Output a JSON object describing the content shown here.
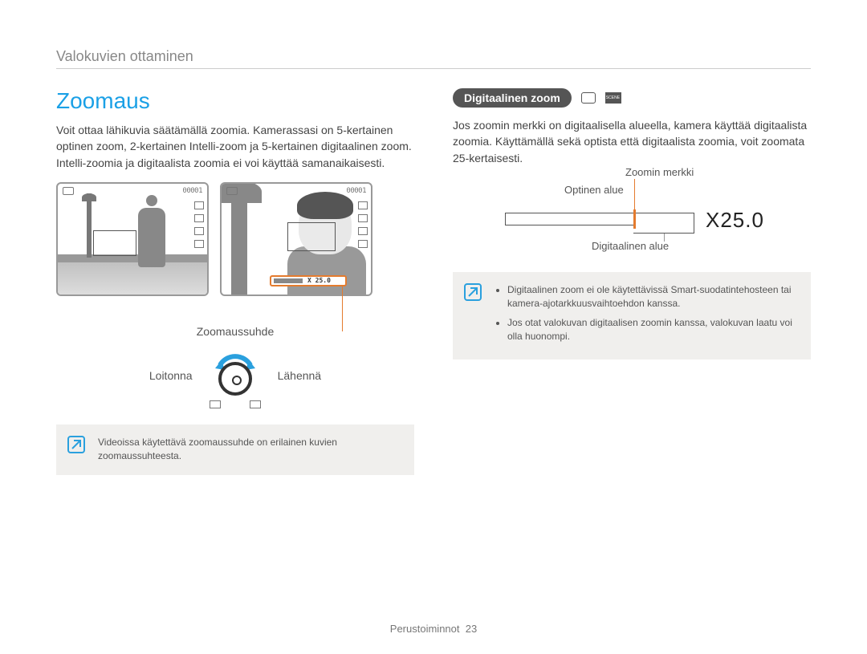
{
  "breadcrumb": "Valokuvien ottaminen",
  "left": {
    "title": "Zoomaus",
    "paragraph": "Voit ottaa lähikuvia säätämällä zoomia. Kamerassasi on 5-kertainen optinen zoom, 2-kertainen Intelli-zoom ja 5-kertainen digitaalinen zoom. Intelli-zoomia ja digitaalista zoomia ei voi käyttää samanaikaisesti.",
    "screen_counter": "00001",
    "zoombar_value": "X 25.0",
    "caption_zoomratio": "Zoomaussuhde",
    "label_out": "Loitonna",
    "label_in": "Lähennä",
    "note": "Videoissa käytettävä zoomaussuhde on erilainen kuvien zoomaussuhteesta."
  },
  "right": {
    "pill": "Digitaalinen zoom",
    "paragraph": "Jos zoomin merkki on digitaalisella alueella, kamera käyttää digitaalista zoomia. Käyttämällä sekä optista että digitaalista zoomia, voit zoomata 25-kertaisesti.",
    "label_marker": "Zoomin merkki",
    "label_optical": "Optinen alue",
    "label_digital": "Digitaalinen alue",
    "x_value": "X25.0",
    "notes": [
      "Digitaalinen zoom ei ole käytettävissä Smart-suodatintehosteen tai kamera-ajotarkkuusvaihtoehdon kanssa.",
      "Jos otat valokuvan digitaalisen zoomin kanssa, valokuvan laatu voi olla huonompi."
    ]
  },
  "footer": {
    "section": "Perustoiminnot",
    "page": "23"
  }
}
